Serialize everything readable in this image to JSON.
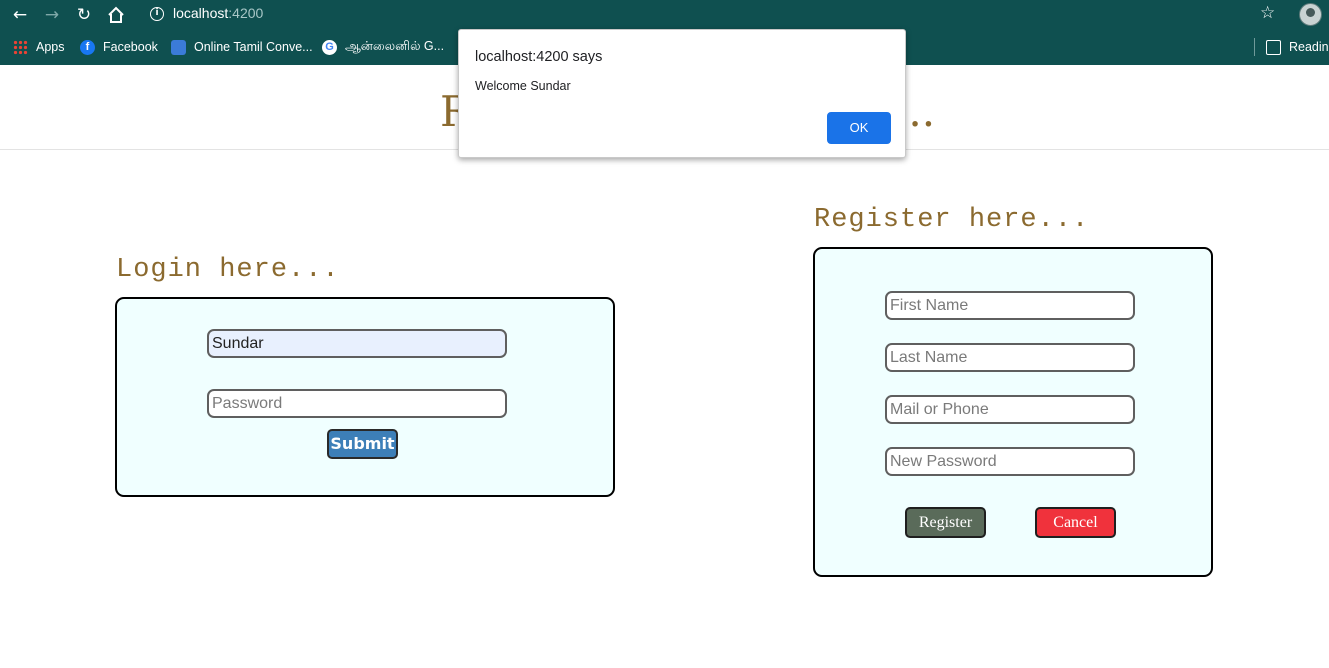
{
  "browser": {
    "url_host": "localhost",
    "url_port": ":4200",
    "bookmarks": [
      {
        "label": "Apps",
        "icon": "apps-grid-icon"
      },
      {
        "label": "Facebook",
        "icon": "facebook-icon"
      },
      {
        "label": "Online Tamil Conve...",
        "icon": "tamil-converter-icon"
      },
      {
        "label": "ஆன்லைனில் G...",
        "icon": "google-icon"
      }
    ],
    "reading_list": "Reading",
    "icons": {
      "back": "back-arrow-icon",
      "forward": "forward-arrow-icon",
      "reload": "reload-icon",
      "home": "home-icon",
      "info": "info-icon",
      "star": "star-icon"
    }
  },
  "page": {
    "header_title_visible": "R",
    "header_title_tail": "..."
  },
  "login": {
    "title": "Login here...",
    "username_value": "Sundar",
    "password_placeholder": "Password",
    "submit_label": "Submit"
  },
  "register": {
    "title": "Register here...",
    "first_name_placeholder": "First Name",
    "last_name_placeholder": "Last Name",
    "contact_placeholder": "Mail or Phone",
    "password_placeholder": "New Password",
    "register_label": "Register",
    "cancel_label": "Cancel"
  },
  "dialog": {
    "title": "localhost:4200 says",
    "message": "Welcome Sundar",
    "ok_label": "OK"
  },
  "colors": {
    "chrome": "#0f5050",
    "heading": "#8b6a2f",
    "form_bg": "#f0ffff",
    "submit": "#3d7fb8",
    "register": "#5a6b5a",
    "cancel": "#f0323c",
    "ok": "#1a73e8"
  }
}
